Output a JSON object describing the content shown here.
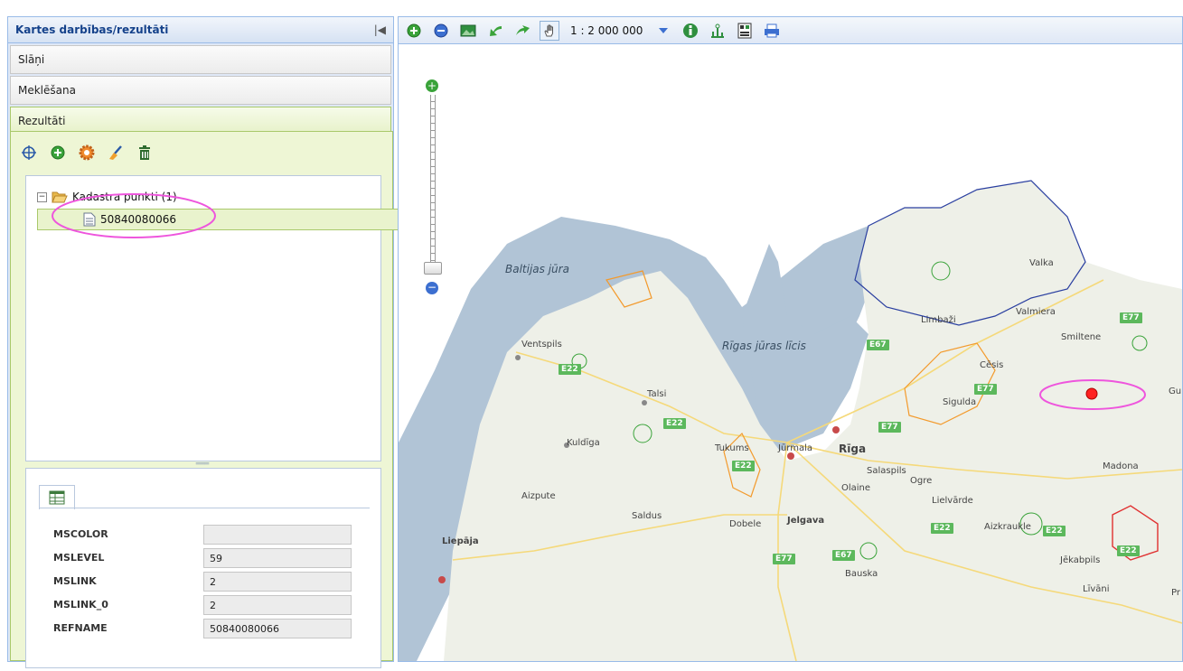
{
  "left_panel": {
    "title": "Kartes darbības/rezultāti",
    "sections": [
      {
        "label": "Slāņi"
      },
      {
        "label": "Meklēšana"
      },
      {
        "label": "Rezultāti"
      }
    ],
    "tree": {
      "group_label": "Kadastra punkti (1)",
      "item_label": "50840080066"
    },
    "attributes": [
      {
        "name": "MSCOLOR",
        "value": ""
      },
      {
        "name": "MSLEVEL",
        "value": "59"
      },
      {
        "name": "MSLINK",
        "value": "2"
      },
      {
        "name": "MSLINK_0",
        "value": "2"
      },
      {
        "name": "REFNAME",
        "value": "50840080066"
      }
    ]
  },
  "map_toolbar": {
    "scale": "1 : 2 000 000",
    "icons": [
      "zoom-in-icon",
      "zoom-out-icon",
      "full-extent-icon",
      "back-icon",
      "forward-icon",
      "pan-hand-icon",
      "info-icon",
      "measure-icon",
      "coordinates-icon",
      "print-icon"
    ]
  },
  "map": {
    "sea_labels": [
      "Baltijas jūra",
      "Rīgas jūras līcis"
    ],
    "cities": [
      "Ventspils",
      "Talsi",
      "Kuldīga",
      "Tukums",
      "Jūrmala",
      "Rīga",
      "Salaspils",
      "Ogre",
      "Olaine",
      "Jelgava",
      "Dobele",
      "Saldus",
      "Aizpute",
      "Liepāja",
      "Bauska",
      "Limbaži",
      "Valka",
      "Valmiera",
      "Smiltene",
      "Cēsis",
      "Sigulda",
      "Lielvārde",
      "Aizkraukle",
      "Jēkabpils",
      "Līvāni",
      "Madona",
      "Gul",
      "Pr"
    ],
    "road_labels": [
      "E22",
      "E22",
      "E22",
      "E67",
      "E77",
      "E22",
      "E77",
      "E67",
      "E77",
      "E22",
      "E22",
      "E22",
      "E77"
    ],
    "colors": {
      "sea": "#b1c4d6",
      "land": "#eef0e8",
      "highlight": "#ee55dd",
      "marker": "#ff2222"
    }
  }
}
